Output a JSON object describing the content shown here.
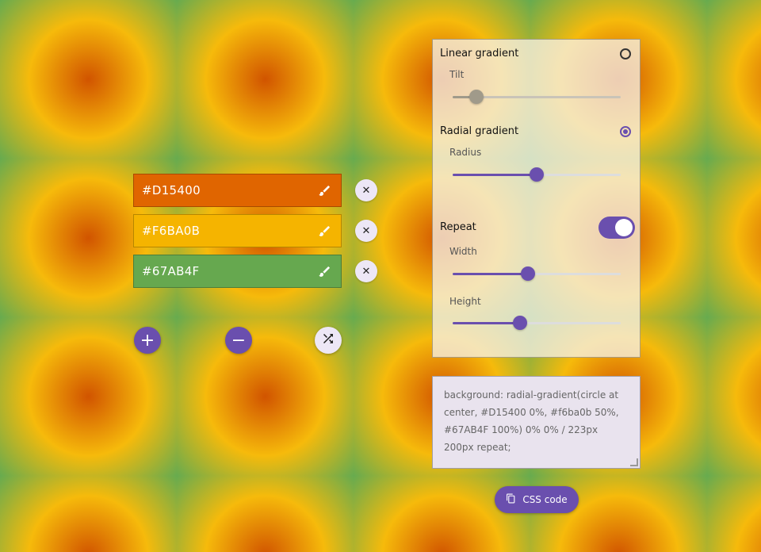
{
  "colors": [
    {
      "hex": "#D15400",
      "bg": "#e06500"
    },
    {
      "hex": "#F6BA0B",
      "bg": "#f5b400"
    },
    {
      "hex": "#67AB4F",
      "bg": "#66a84f"
    }
  ],
  "icons": {
    "brush": "brush-icon",
    "remove": "close-icon",
    "add": "plus-icon",
    "subtract": "minus-icon",
    "shuffle": "shuffle-icon",
    "copy": "copy-icon"
  },
  "panel": {
    "linear": {
      "label": "Linear gradient",
      "checked": false,
      "tilt_label": "Tilt",
      "tilt_value": 0.14
    },
    "radial": {
      "label": "Radial gradient",
      "checked": true,
      "radius_label": "Radius",
      "radius_value": 0.5
    },
    "repeat": {
      "label": "Repeat",
      "enabled": true,
      "width_label": "Width",
      "width_value": 0.45,
      "height_label": "Height",
      "height_value": 0.4
    }
  },
  "code": {
    "text": "background: radial-gradient(circle at center, #D15400 0%, #f6ba0b 50%, #67AB4F 100%) 0% 0% / 223px 200px repeat;"
  },
  "css_button": {
    "label": "CSS code"
  },
  "accent": "#6a4fae"
}
